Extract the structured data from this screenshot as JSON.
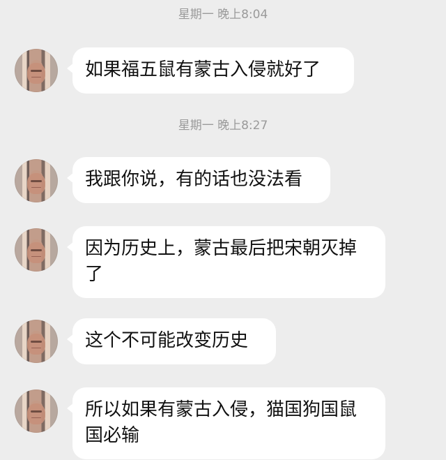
{
  "timestamps": [
    "星期一 晚上8:04",
    "星期一 晚上8:27"
  ],
  "messages": [
    {
      "text": "如果福五鼠有蒙古入侵就好了",
      "avatar": "person-avatar"
    },
    {
      "text": "我跟你说，有的话也没法看",
      "avatar": "person-avatar"
    },
    {
      "text": "因为历史上，蒙古最后把宋朝灭掉了",
      "avatar": "person-avatar"
    },
    {
      "text": "这个不可能改变历史",
      "avatar": "person-avatar"
    },
    {
      "text": "所以如果有蒙古入侵，猫国狗国鼠国必输",
      "avatar": "person-avatar"
    }
  ],
  "colors": {
    "background": "#ededed",
    "bubble": "#ffffff",
    "timestamp": "#9a9a9a",
    "text": "#111111"
  }
}
